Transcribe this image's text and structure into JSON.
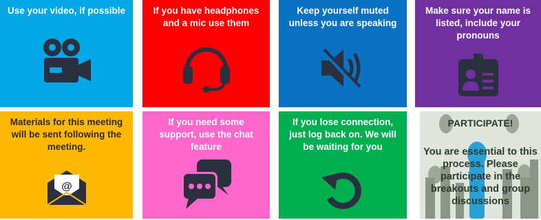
{
  "tiles": [
    {
      "text": "Use your video, if possible",
      "color": "#00a8e8",
      "icon": "video-camera-icon"
    },
    {
      "text": "If you have headphones and a mic use them",
      "color": "#ff0000",
      "icon": "headset-icon"
    },
    {
      "text": "Keep yourself muted unless you are speaking",
      "color": "#0a72c2",
      "icon": "muted-speaker-icon"
    },
    {
      "text": "Make sure your name is listed, include your pronouns",
      "color": "#7030a0",
      "icon": "id-badge-icon"
    },
    {
      "text": "Materials for this meeting will be sent following the meeting.",
      "color": "#ffb800",
      "icon": "email-envelope-icon",
      "text_color": "#2b2b2b"
    },
    {
      "text": "If you need some support, use the chat feature",
      "color": "#ff66cc",
      "icon": "chat-bubbles-icon"
    },
    {
      "text": "If you lose connection, just log back on. We will be waiting for you",
      "color": "#00b050",
      "icon": "reconnect-arrow-icon"
    }
  ],
  "participate": {
    "title": "PARTICIPATE!",
    "body": "You are essential to this process. Please participate in the breakouts and group discussions"
  },
  "icon_color": "#2b3040"
}
